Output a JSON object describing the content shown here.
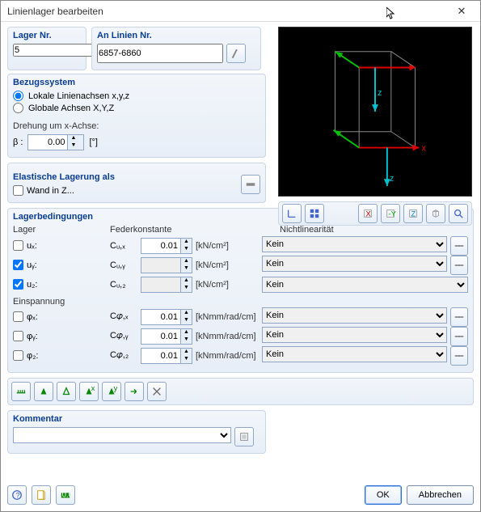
{
  "window": {
    "title": "Linienlager bearbeiten"
  },
  "lager_nr": {
    "label": "Lager Nr.",
    "value": "5"
  },
  "an_linien": {
    "label": "An Linien Nr.",
    "value": "6857-6860"
  },
  "bezug": {
    "title": "Bezugssystem",
    "lokal": "Lokale Linienachsen x,y,z",
    "global": "Globale Achsen X,Y,Z",
    "drehung_label": "Drehung um x-Achse:",
    "beta": "β :",
    "beta_value": "0.00",
    "beta_unit": "[°]"
  },
  "elastische": {
    "title": "Elastische Lagerung als",
    "wand": "Wand in Z..."
  },
  "lagerbed": {
    "title": "Lagerbedingungen",
    "lager": "Lager",
    "feder": "Federkonstante",
    "nicht": "Nichtlinearität",
    "einsp": "Einspannung",
    "rows": [
      {
        "sym": "uₓ:",
        "coef": "Cᵤ,ₓ",
        "val": "0.01",
        "unit": "[kN/cm²]",
        "enabled": true,
        "checked": false,
        "sel": "Kein"
      },
      {
        "sym": "uᵧ:",
        "coef": "Cᵤ,ᵧ",
        "val": "",
        "unit": "[kN/cm²]",
        "enabled": false,
        "checked": true,
        "sel": "Kein"
      },
      {
        "sym": "u₂:",
        "coef": "Cᵤ,₂",
        "val": "",
        "unit": "[kN/cm²]",
        "enabled": false,
        "checked": true,
        "sel": "Kein",
        "selwide": true
      }
    ],
    "erows": [
      {
        "sym": "φₓ:",
        "coef": "C𝜑,ₓ",
        "val": "0.01",
        "unit": "[kNmm/rad/cm]",
        "sel": "Kein"
      },
      {
        "sym": "φᵧ:",
        "coef": "C𝜑,ᵧ",
        "val": "0.01",
        "unit": "[kNmm/rad/cm]",
        "sel": "Kein"
      },
      {
        "sym": "φ₂:",
        "coef": "C𝜑,₂",
        "val": "0.01",
        "unit": "[kNmm/rad/cm]",
        "sel": "Kein"
      }
    ]
  },
  "kommentar": {
    "title": "Kommentar"
  },
  "buttons": {
    "ok": "OK",
    "cancel": "Abbrechen"
  }
}
